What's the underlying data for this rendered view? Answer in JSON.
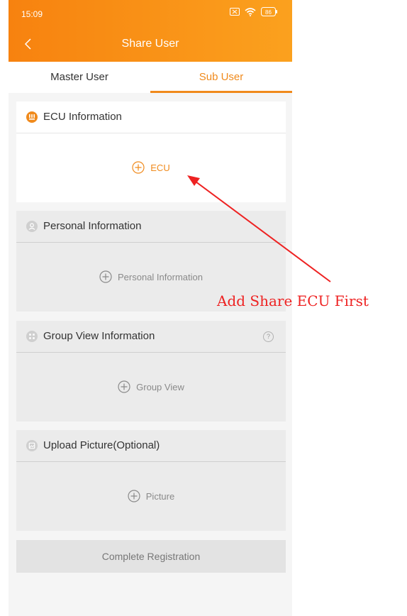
{
  "status_bar": {
    "time": "15:09",
    "battery": "86"
  },
  "header": {
    "title": "Share User"
  },
  "tabs": [
    {
      "label": "Master User",
      "active": false
    },
    {
      "label": "Sub User",
      "active": true
    }
  ],
  "sections": {
    "ecu": {
      "title": "ECU Information",
      "add_label": "ECU",
      "enabled": true
    },
    "personal": {
      "title": "Personal Information",
      "add_label": "Personal Information",
      "enabled": false
    },
    "group": {
      "title": "Group View Information",
      "add_label": "Group View",
      "enabled": false,
      "help": "?"
    },
    "picture": {
      "title": "Upload Picture(Optional)",
      "add_label": "Picture",
      "enabled": false
    }
  },
  "footer": {
    "complete_label": "Complete Registration"
  },
  "annotation": {
    "text": "Add Share ECU First",
    "color": "#ee2222"
  },
  "colors": {
    "accent": "#f08a1c",
    "header_start": "#f7820f",
    "header_end": "#fba11e"
  }
}
